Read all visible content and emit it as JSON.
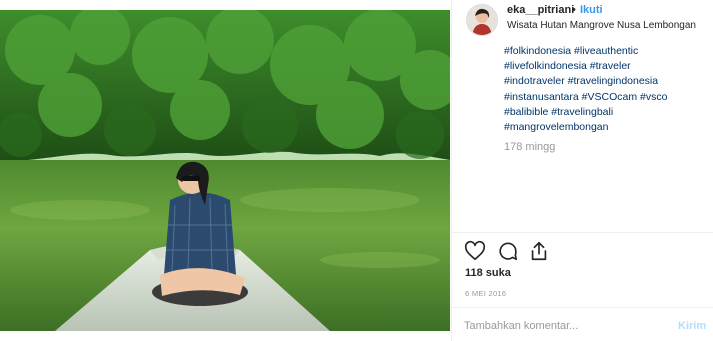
{
  "post": {
    "username": "eka__pitriani",
    "dot": "•",
    "follow_label": "Ikuti",
    "location": "Wisata Hutan Mangrove Nusa Lembongan"
  },
  "caption": {
    "hashtags": [
      "#folkindonesia #liveauthentic",
      "#livefolkindonesia #traveler",
      "#indotraveler #travelingindonesia",
      "#instanusantara #VSCOcam #vsco",
      "#balibible #travelingbali",
      "#mangrovelembongan"
    ],
    "time_ago": "178 mingg"
  },
  "actions": {
    "icons": [
      "heart-icon",
      "comment-icon",
      "share-icon"
    ]
  },
  "likes": {
    "text": "118 suka"
  },
  "date": {
    "text": "6 MEI 2016"
  },
  "comment": {
    "placeholder": "Tambahkan komentar...",
    "send_label": "Kirim"
  },
  "colors": {
    "link": "#003569",
    "follow": "#3897f0",
    "send_disabled": "#b2dffc",
    "muted": "#999999"
  }
}
